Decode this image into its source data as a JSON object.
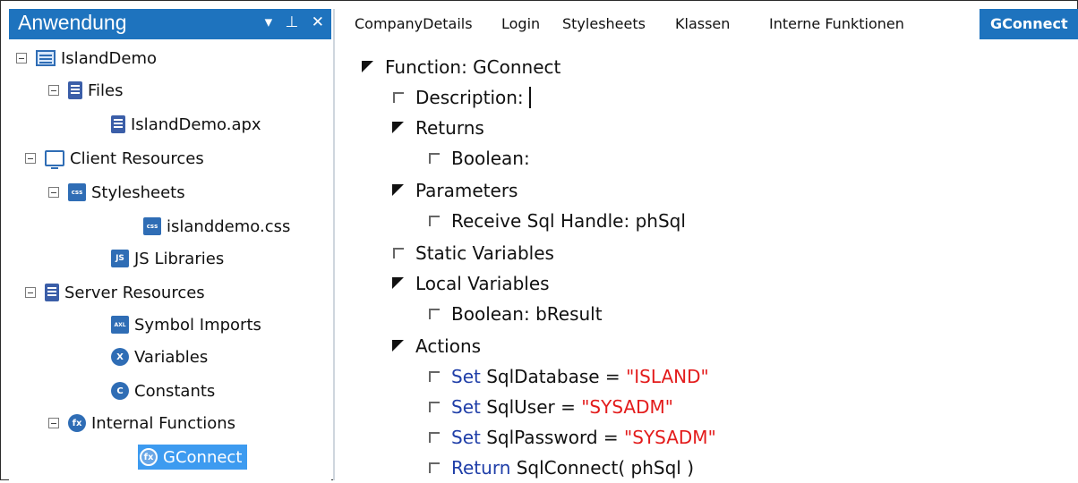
{
  "panel": {
    "title": "Anwendung",
    "pin_glyph": "▾",
    "dock_glyph": "⊥",
    "close_glyph": "✕"
  },
  "tree": {
    "project": "IslandDemo",
    "files": "Files",
    "file_apx": "IslandDemo.apx",
    "client_resources": "Client Resources",
    "stylesheets": "Stylesheets",
    "css_file": "islanddemo.css",
    "js_libraries": "JS Libraries",
    "server_resources": "Server Resources",
    "symbol_imports": "Symbol Imports",
    "variables": "Variables",
    "constants": "Constants",
    "internal_functions": "Internal Functions",
    "gconnect": "GConnect",
    "icons": {
      "css": "css",
      "js": "JS",
      "axl": "AXL",
      "xml": "X",
      "constant": "C",
      "function": "fx"
    }
  },
  "tabs": [
    {
      "label": "CompanyDetails"
    },
    {
      "label": "Login"
    },
    {
      "label": "Stylesheets"
    },
    {
      "label": "Klassen"
    },
    {
      "label": "Interne Funktionen"
    },
    {
      "label": "GConnect"
    }
  ],
  "editor": {
    "function": "Function: GConnect",
    "description": "Description:",
    "returns": "Returns",
    "returns_type": "Boolean:",
    "parameters": "Parameters",
    "param": "Receive Sql Handle: phSql",
    "static_vars": "Static Variables",
    "local_vars": "Local Variables",
    "local_var": "Boolean: bResult",
    "actions": "Actions",
    "stmt1": {
      "kw": "Set",
      "lhs": " SqlDatabase = ",
      "str": "\"ISLAND\""
    },
    "stmt2": {
      "kw": "Set",
      "lhs": " SqlUser = ",
      "str": "\"SYSADM\""
    },
    "stmt3": {
      "kw": "Set",
      "lhs": " SqlPassword = ",
      "str": "\"SYSADM\""
    },
    "stmt4": {
      "kw": "Return",
      "rest": " SqlConnect( phSql )"
    }
  }
}
